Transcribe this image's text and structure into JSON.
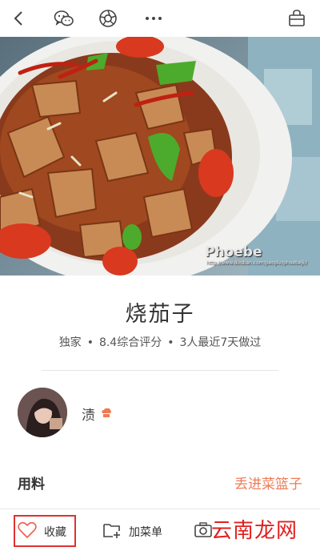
{
  "nav": {
    "icons": [
      "back-icon",
      "wechat-icon",
      "moments-icon",
      "more-icon",
      "basket-icon"
    ],
    "more_label": "···"
  },
  "hero": {
    "watermark": "Phoebe",
    "watermark_url": "http://www.douban.com/people/phoebejk/"
  },
  "recipe": {
    "title": "烧茄子",
    "tag": "独家",
    "rating": "8.4综合评分",
    "cooked": "3人最近7天做过",
    "separator": "•"
  },
  "author": {
    "name": "渍",
    "badge_icon": "chef-hat-icon"
  },
  "ingredients": {
    "label": "用料",
    "add_to_basket": "丢进菜篮子"
  },
  "bottom_bar": {
    "favorite_label": "收藏",
    "add_menu_label": "加菜单",
    "site_mark": "云南龙网"
  },
  "colors": {
    "accent": "#ef7b55",
    "highlight_box": "#e03030",
    "site_mark": "#e02020"
  }
}
